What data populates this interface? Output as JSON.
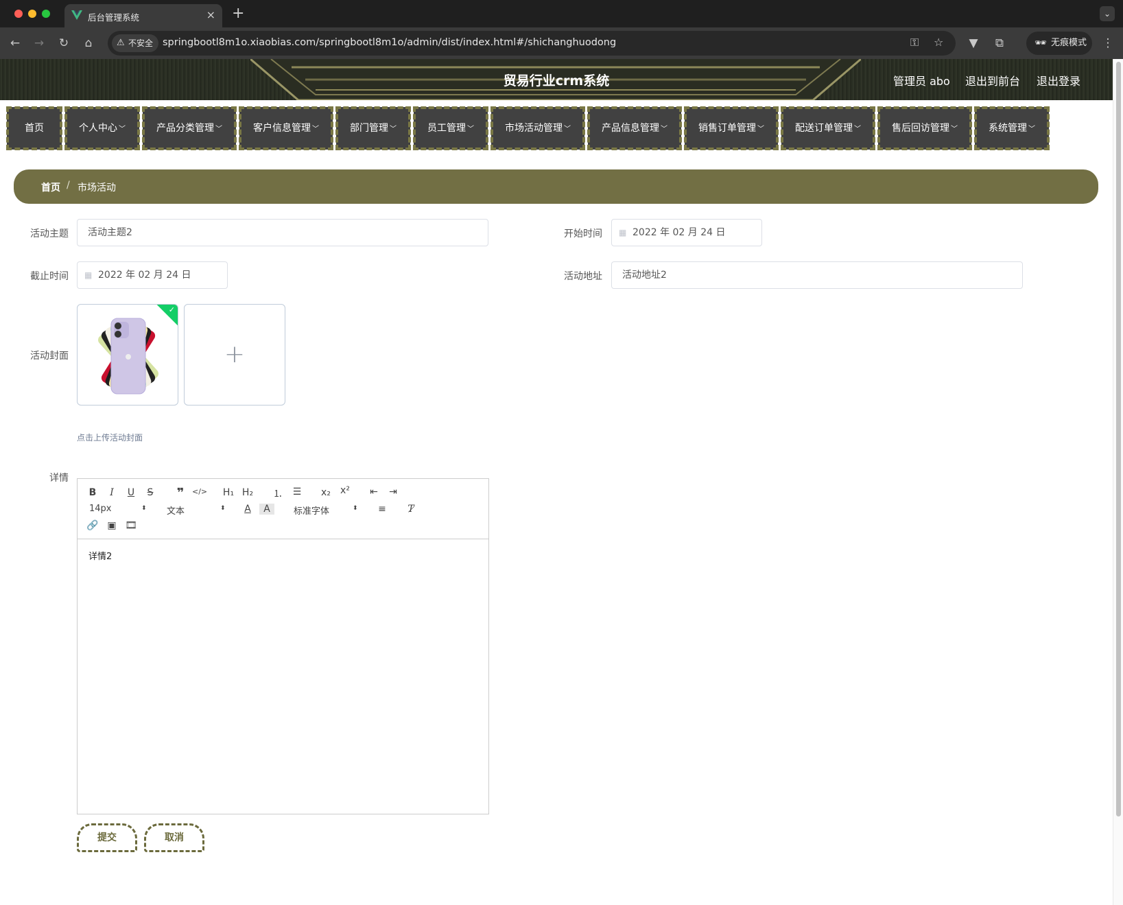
{
  "browser": {
    "tab_title": "后台管理系统",
    "insecure_label": "不安全",
    "url": "springbootl8m1o.xiaobias.com/springbootl8m1o/admin/dist/index.html#/shichanghuodong",
    "incognito_label": "无痕模式"
  },
  "header": {
    "title": "贸易行业crm系统",
    "user": "管理员 abo",
    "to_front": "退出到前台",
    "logout": "退出登录"
  },
  "nav": [
    {
      "label": "首页",
      "has_dropdown": false
    },
    {
      "label": "个人中心",
      "has_dropdown": true
    },
    {
      "label": "产品分类管理",
      "has_dropdown": true
    },
    {
      "label": "客户信息管理",
      "has_dropdown": true
    },
    {
      "label": "部门管理",
      "has_dropdown": true
    },
    {
      "label": "员工管理",
      "has_dropdown": true
    },
    {
      "label": "市场活动管理",
      "has_dropdown": true
    },
    {
      "label": "产品信息管理",
      "has_dropdown": true
    },
    {
      "label": "销售订单管理",
      "has_dropdown": true
    },
    {
      "label": "配送订单管理",
      "has_dropdown": true
    },
    {
      "label": "售后回访管理",
      "has_dropdown": true
    },
    {
      "label": "系统管理",
      "has_dropdown": true
    }
  ],
  "breadcrumb": {
    "home": "首页",
    "separator": "/",
    "current": "市场活动"
  },
  "form": {
    "subject_label": "活动主题",
    "subject_value": "活动主题2",
    "start_label": "开始时间",
    "start_value": "2022 年 02 月 24 日",
    "end_label": "截止时间",
    "end_value": "2022 年 02 月 24 日",
    "address_label": "活动地址",
    "address_value": "活动地址2",
    "cover_label": "活动封面",
    "upload_tip": "点击上传活动封面",
    "detail_label": "详情",
    "detail_content": "详情2",
    "submit": "提交",
    "cancel": "取消"
  },
  "editor_toolbar": {
    "font_size": "14px",
    "header": "文本",
    "font_family": "标准字体",
    "h1": "H₁",
    "h2": "H₂"
  },
  "colors": {
    "accent": "#726f44",
    "nav_bg": "#414141",
    "nav_border": "#7a7845",
    "success": "#13ce66"
  }
}
